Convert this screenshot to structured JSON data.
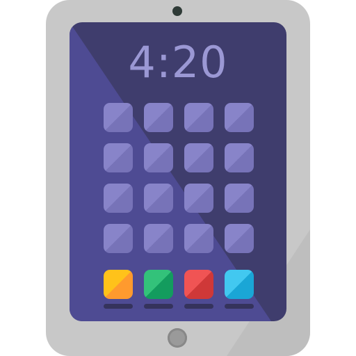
{
  "status": {
    "time": "4:20"
  },
  "home_screen": {
    "app_icon_count": 16,
    "rows": 4,
    "columns": 4
  },
  "dock": {
    "apps": [
      {
        "name": "dock-app-yellow",
        "color_light": "#ffc21a",
        "color_dark": "#ff9a2e"
      },
      {
        "name": "dock-app-green",
        "color_light": "#33c27a",
        "color_dark": "#139c5e"
      },
      {
        "name": "dock-app-red",
        "color_light": "#f05454",
        "color_dark": "#cf3838"
      },
      {
        "name": "dock-app-blue",
        "color_light": "#42c8f0",
        "color_dark": "#1aa6d6"
      }
    ]
  },
  "colors": {
    "bezel": "#c8c8c8",
    "bezel_shade": "#b4b4b4",
    "screen_dark": "#3f3d6d",
    "screen_light": "#4e4b93",
    "app_icon": "#8884c9",
    "clock_text": "#9b98d4"
  }
}
